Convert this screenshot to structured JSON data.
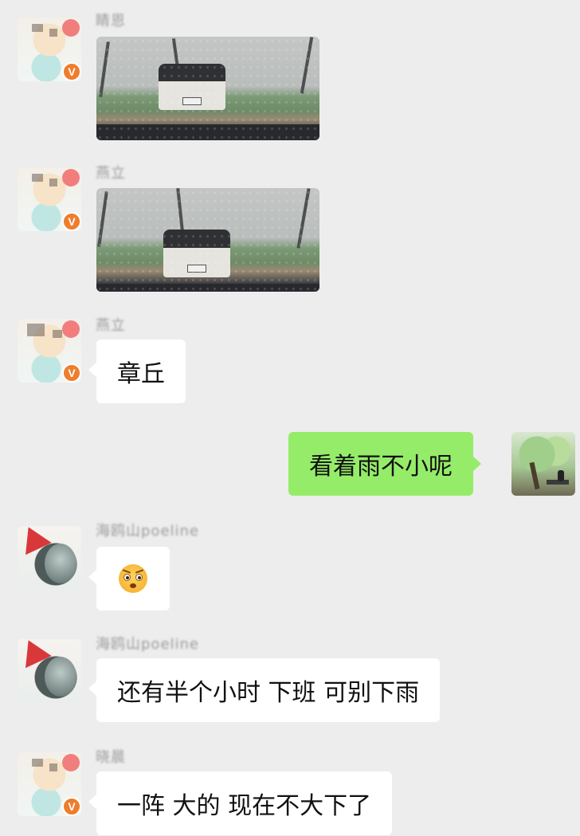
{
  "chat": {
    "messages": [
      {
        "name": "睛恩",
        "type": "photo"
      },
      {
        "name": "燕立",
        "type": "photo"
      },
      {
        "name": "燕立",
        "type": "text",
        "text": "章丘"
      },
      {
        "type": "text",
        "side": "right",
        "text": "看着雨不小呢"
      },
      {
        "name": "海鸥山poeline",
        "type": "emoji",
        "emoji_name": "stunned-face-icon"
      },
      {
        "name": "海鸥山poeline",
        "type": "text",
        "text": "还有半个小时 下班 可别下雨"
      },
      {
        "name": "晓晨",
        "type": "text",
        "text": "一阵 大的 现在不大下了"
      }
    ],
    "badge_letter": "V",
    "colors": {
      "background": "#ededed",
      "sent_bubble": "#95ec69",
      "received_bubble": "#ffffff",
      "badge": "#ee7d2c"
    }
  }
}
